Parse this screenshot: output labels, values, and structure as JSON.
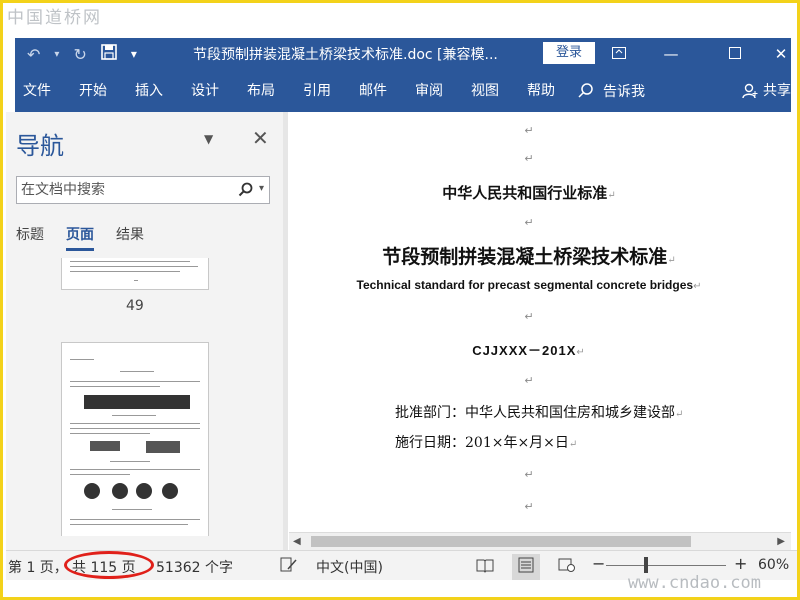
{
  "watermark": {
    "top": "中国道桥网",
    "bottom": "www.cndao.com"
  },
  "titlebar": {
    "doc_title": "节段预制拼装混凝土桥梁技术标准.doc [兼容模...",
    "login_label": "登录",
    "qa_dropdown": "▾"
  },
  "ribbon": {
    "tabs": [
      "文件",
      "开始",
      "插入",
      "设计",
      "布局",
      "引用",
      "邮件",
      "审阅",
      "视图",
      "帮助"
    ],
    "tell_me": "告诉我",
    "share": "共享"
  },
  "nav": {
    "title": "导航",
    "search_placeholder": "在文档中搜索",
    "tabs": [
      "标题",
      "页面",
      "结果"
    ],
    "page_number": "49"
  },
  "document": {
    "line1": "中华人民共和国行业标准",
    "line2": "节段预制拼装混凝土桥梁技术标准",
    "line3": "Technical standard for precast segmental concrete bridges",
    "line4": "CJJXXX－201X",
    "line5": "批准部门：中华人民共和国住房和城乡建设部",
    "line6": "施行日期：201×年×月×日",
    "para_mark": "↵"
  },
  "status": {
    "page": "第 1 页，",
    "total": "共 115 页",
    "words": "51362 个字",
    "language": "中文(中国)",
    "zoom": "60%"
  },
  "colors": {
    "accent": "#2b579a",
    "highlight_circle": "#e0201a",
    "frame": "#f3d21a"
  }
}
